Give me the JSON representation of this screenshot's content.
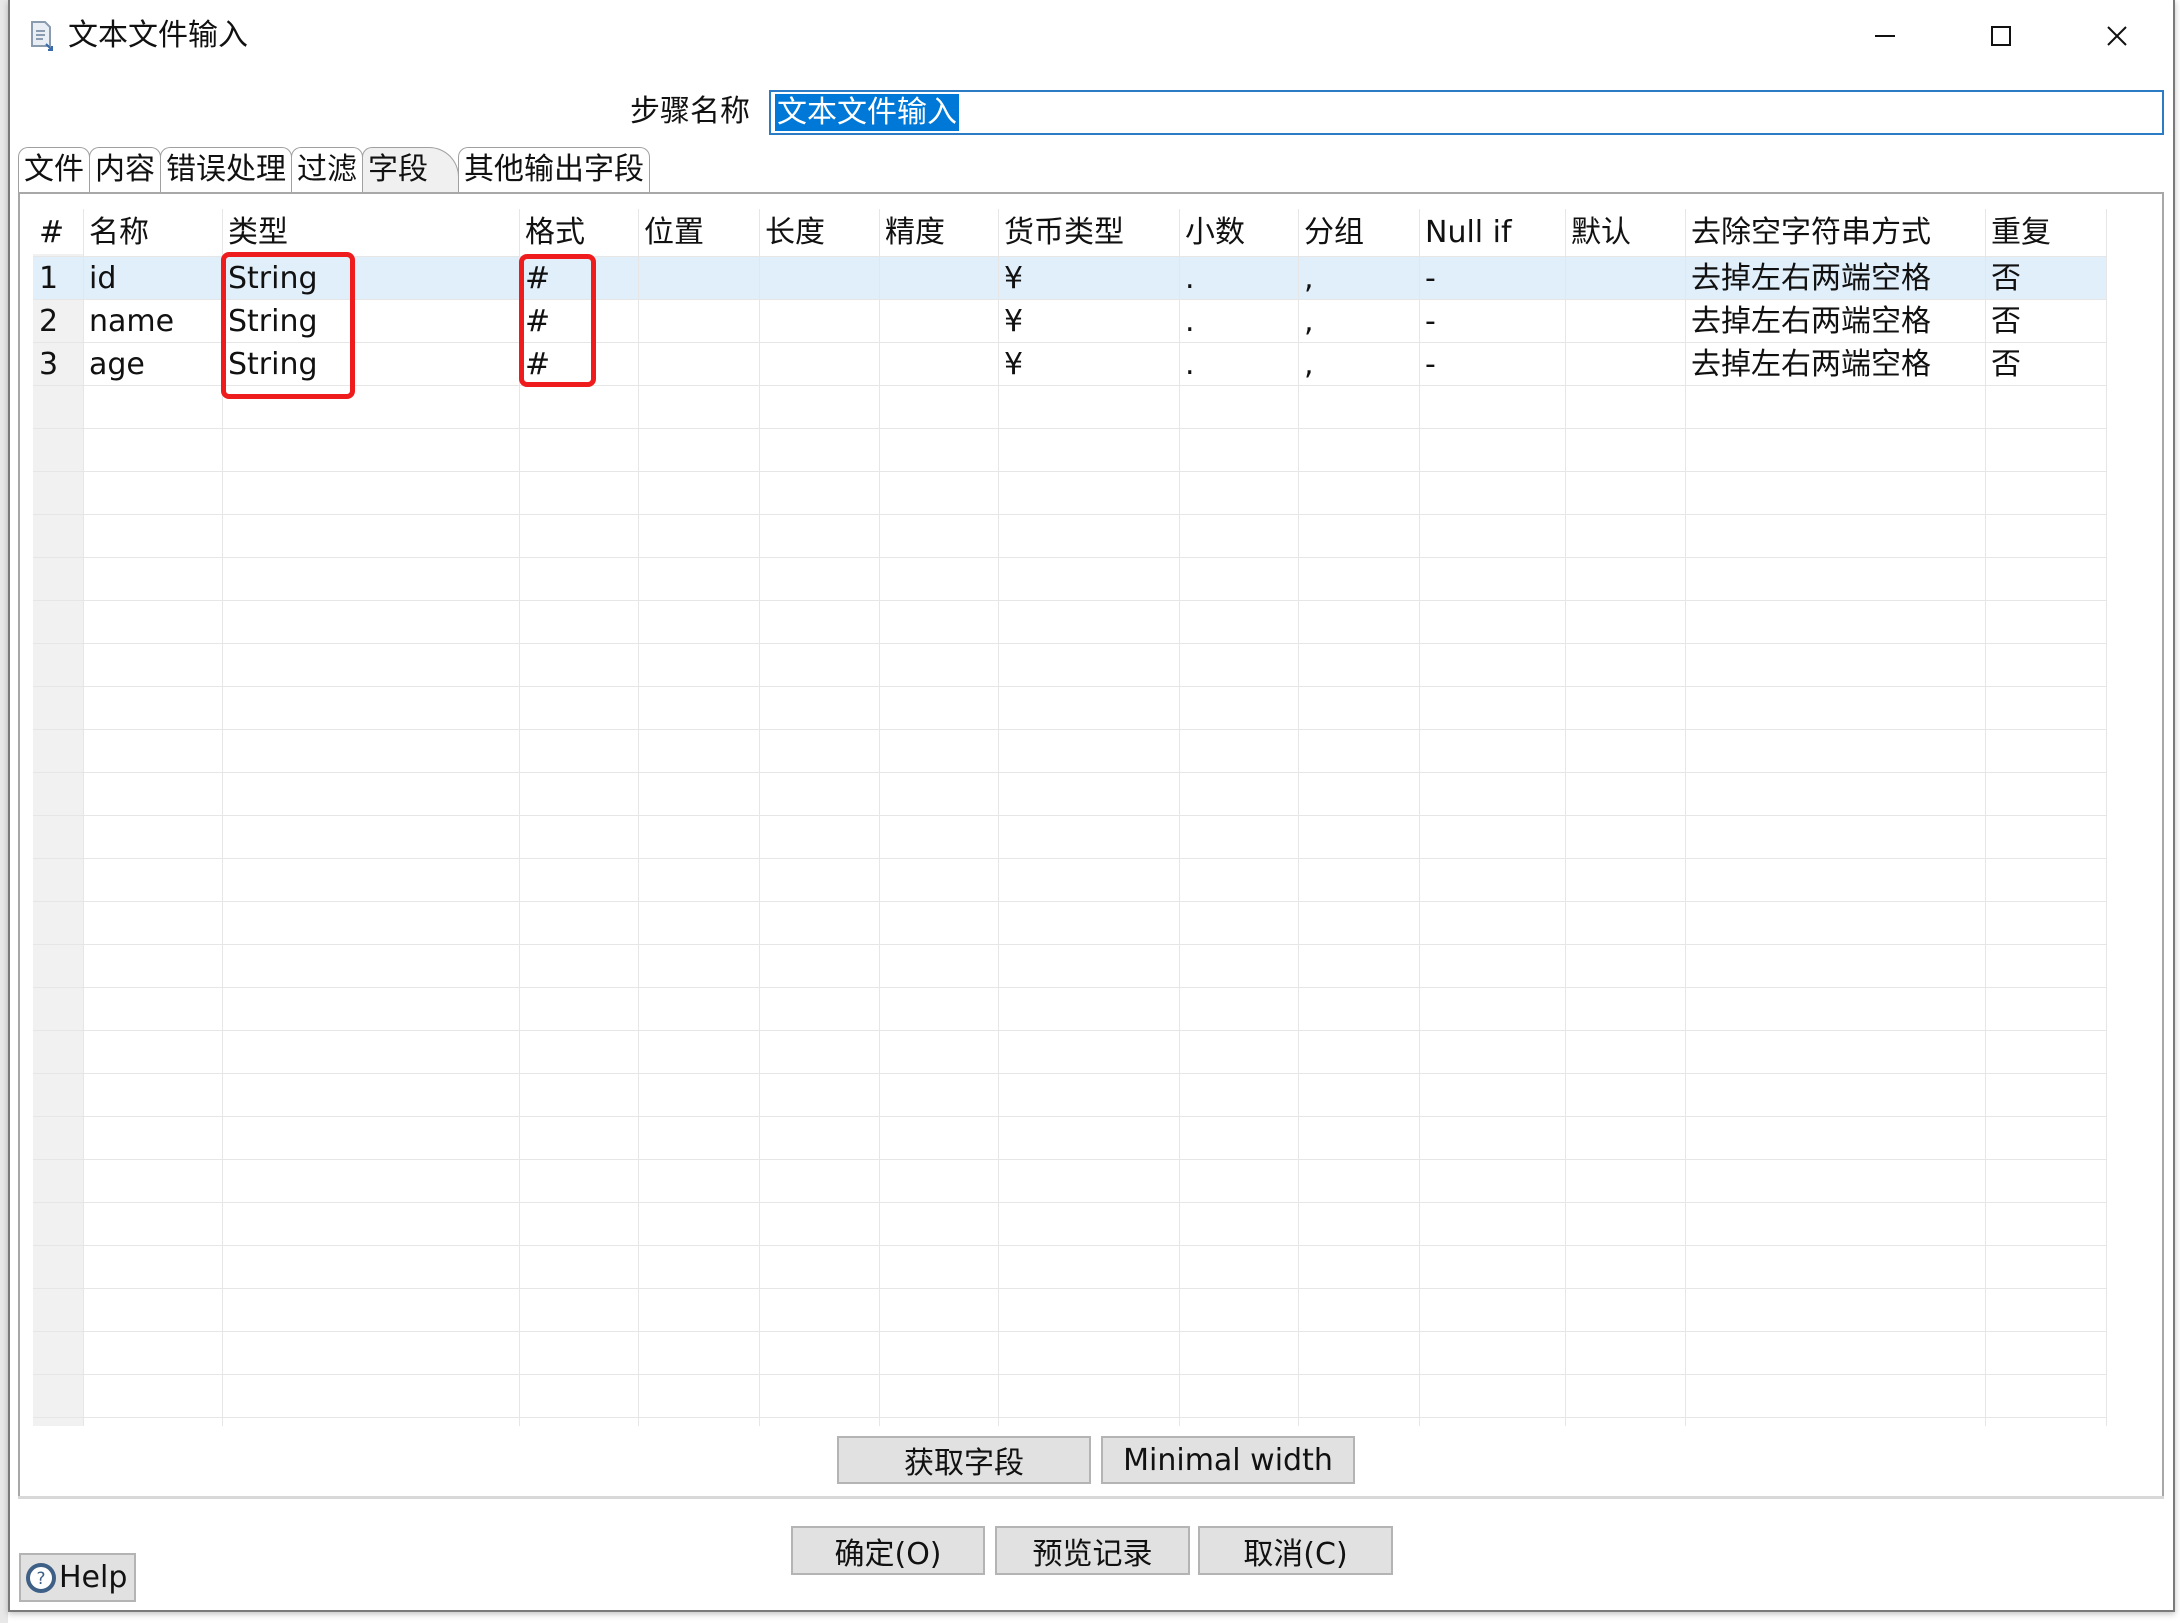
{
  "window": {
    "title": "文本文件输入",
    "icon": "text-file-input-icon",
    "controls": {
      "minimize": "minimize-icon",
      "maximize": "maximize-icon",
      "close": "close-icon"
    }
  },
  "step": {
    "label": "步骤名称",
    "value": "文本文件输入"
  },
  "tabs": [
    {
      "label": "文件",
      "active": false
    },
    {
      "label": "内容",
      "active": false
    },
    {
      "label": "错误处理",
      "active": false
    },
    {
      "label": "过滤",
      "active": false
    },
    {
      "label": "字段",
      "active": true
    },
    {
      "label": "其他输出字段",
      "active": false
    }
  ],
  "table": {
    "columns": [
      "#",
      "名称",
      "类型",
      "格式",
      "位置",
      "长度",
      "精度",
      "货币类型",
      "小数",
      "分组",
      "Null if",
      "默认",
      "去除空字符串方式",
      "重复"
    ],
    "rows": [
      [
        "1",
        "id",
        "String",
        "#",
        "",
        "",
        "",
        "¥",
        ".",
        ",",
        "-",
        "",
        "去掉左右两端空格",
        "否"
      ],
      [
        "2",
        "name",
        "String",
        "#",
        "",
        "",
        "",
        "¥",
        ".",
        ",",
        "-",
        "",
        "去掉左右两端空格",
        "否"
      ],
      [
        "3",
        "age",
        "String",
        "#",
        "",
        "",
        "",
        "¥",
        ".",
        ",",
        "-",
        "",
        "去掉左右两端空格",
        "否"
      ]
    ],
    "selected_row": 0,
    "highlighted_columns": [
      "类型",
      "格式"
    ],
    "highlight_color": "#ee1c1c"
  },
  "panel_buttons": {
    "get_fields": "获取字段",
    "minimal_width": "Minimal width"
  },
  "dialog_buttons": {
    "ok": "确定(O)",
    "preview": "预览记录",
    "cancel": "取消(C)"
  },
  "help": {
    "label": "Help",
    "icon": "help-icon"
  },
  "colors": {
    "selection": "#0078d7",
    "row_highlight": "#e1effb",
    "input_border": "#2b7cc4"
  }
}
